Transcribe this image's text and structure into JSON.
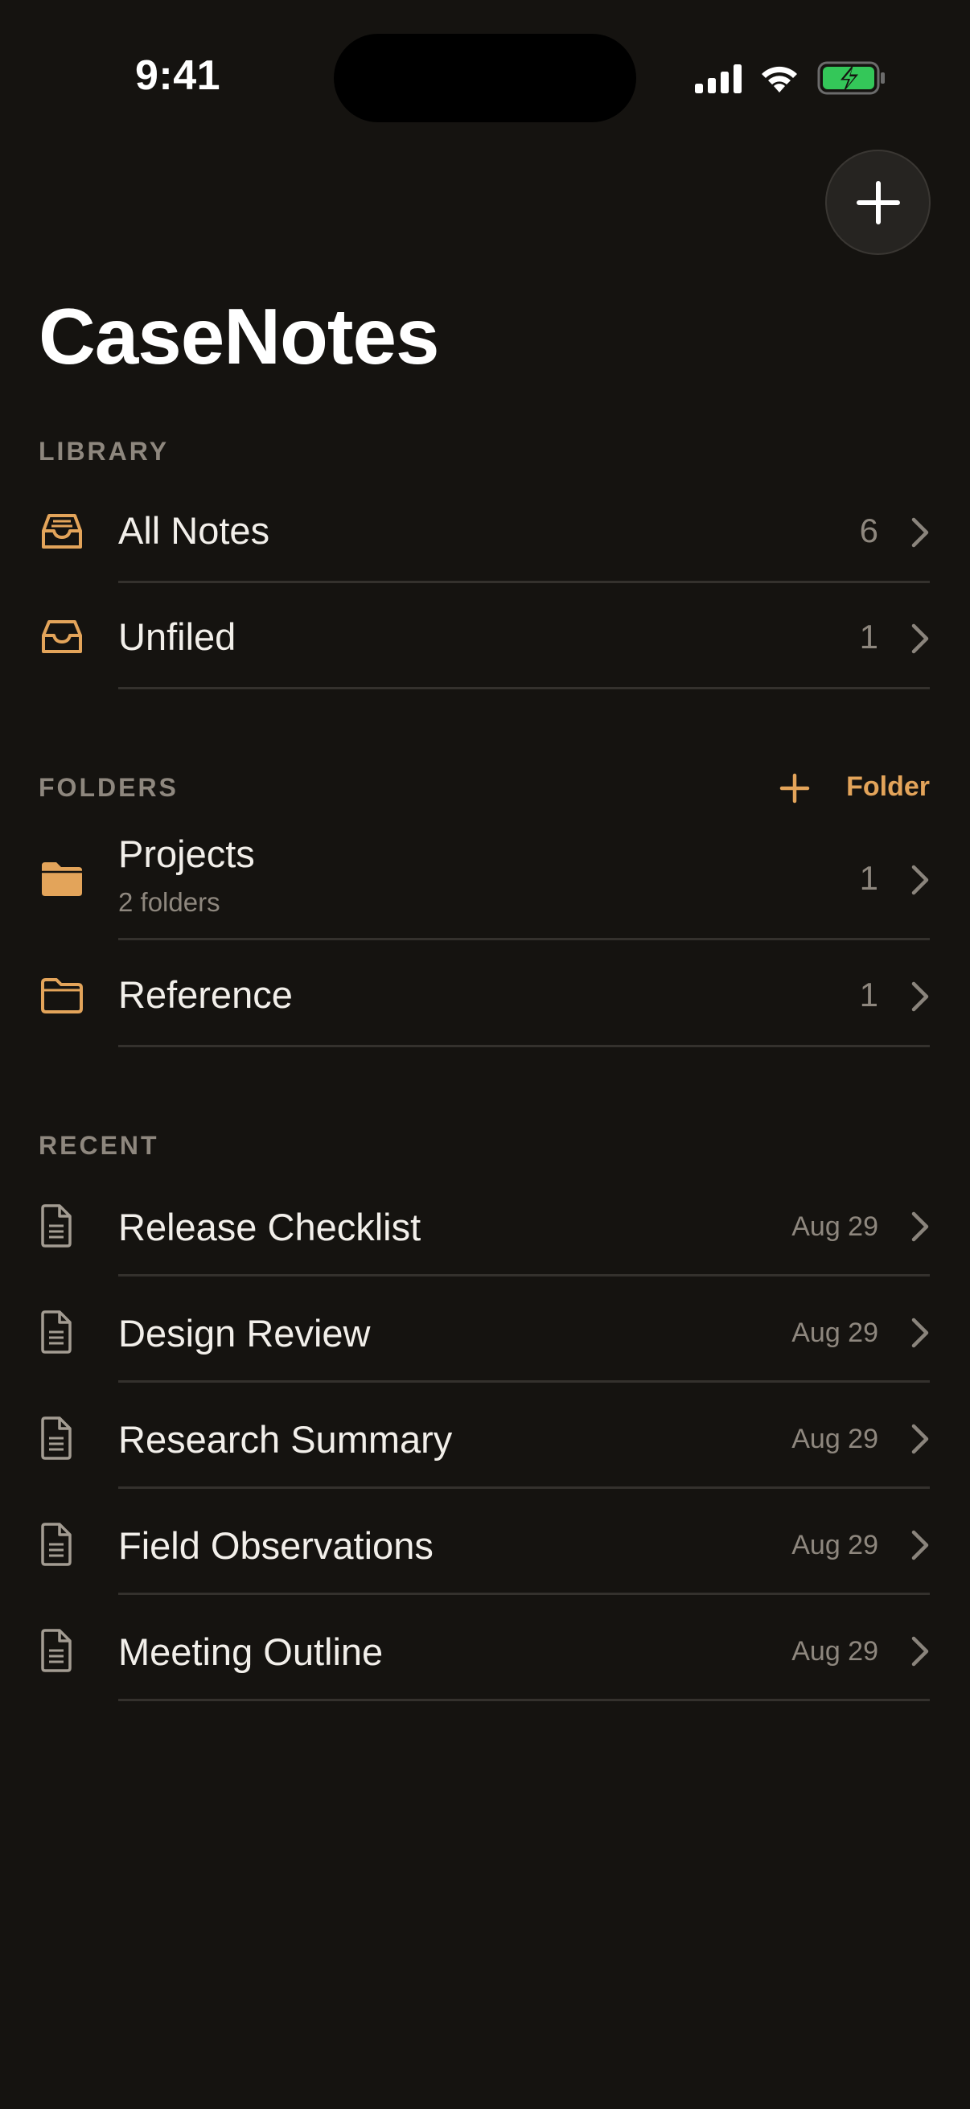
{
  "status_bar": {
    "time": "9:41"
  },
  "app": {
    "title": "CaseNotes"
  },
  "colors": {
    "accent": "#e3a45a",
    "background": "#151310",
    "battery": "#34c759"
  },
  "library": {
    "header": "LIBRARY",
    "items": [
      {
        "label": "All Notes",
        "count": "6",
        "icon": "tray-icon"
      },
      {
        "label": "Unfiled",
        "count": "1",
        "icon": "tray-icon"
      }
    ]
  },
  "folders": {
    "header": "FOLDERS",
    "add_label": "Folder",
    "items": [
      {
        "label": "Projects",
        "subtitle": "2 folders",
        "count": "1",
        "icon": "folder-filled-icon"
      },
      {
        "label": "Reference",
        "count": "1",
        "icon": "folder-outline-icon"
      }
    ]
  },
  "recent": {
    "header": "RECENT",
    "items": [
      {
        "label": "Release Checklist",
        "date": "Aug 29",
        "icon": "document-icon"
      },
      {
        "label": "Design Review",
        "date": "Aug 29",
        "icon": "document-icon"
      },
      {
        "label": "Research Summary",
        "date": "Aug 29",
        "icon": "document-icon"
      },
      {
        "label": "Field Observations",
        "date": "Aug 29",
        "icon": "document-icon"
      },
      {
        "label": "Meeting Outline",
        "date": "Aug 29",
        "icon": "document-icon"
      }
    ]
  }
}
